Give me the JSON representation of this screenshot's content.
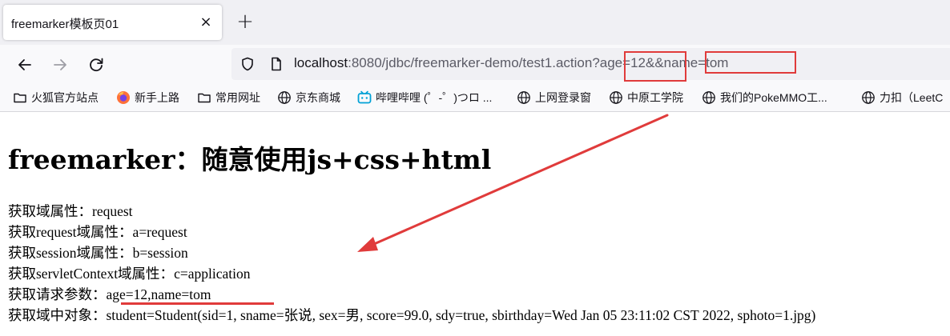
{
  "tab": {
    "title": "freemarker模板页01",
    "close_glyph": "×"
  },
  "new_tab_glyph": "+",
  "nav": {
    "back_icon": "arrow-left-icon",
    "forward_icon": "arrow-right-icon",
    "reload_icon": "reload-icon"
  },
  "url": {
    "host": "localhost",
    "rest": ":8080/jdbc/freemarker-demo/test1.action?age=12&&name=tom"
  },
  "bookmarks": [
    {
      "label": "火狐官方站点",
      "icon": "folder-icon"
    },
    {
      "label": "新手上路",
      "icon": "firefox-icon"
    },
    {
      "label": "常用网址",
      "icon": "folder-icon"
    },
    {
      "label": "京东商城",
      "icon": "globe-icon"
    },
    {
      "label": "哔哩哔哩 (゜-゜)つロ ...",
      "icon": "bilibili-icon"
    },
    {
      "label": "上网登录窗",
      "icon": "globe-icon"
    },
    {
      "label": "中原工学院",
      "icon": "globe-icon"
    },
    {
      "label": "我们的PokeMMO工...",
      "icon": "globe-icon"
    },
    {
      "label": "力扣（LeetC",
      "icon": "globe-icon"
    }
  ],
  "page": {
    "title": "freemarker：随意使用js+css+html",
    "lines": [
      {
        "label": "获取域属性：",
        "value": "request"
      },
      {
        "label": "获取request域属性：",
        "value": "a=request"
      },
      {
        "label": "获取session域属性：",
        "value": "b=session"
      },
      {
        "label": "获取servletContext域属性：",
        "value": "c=application"
      },
      {
        "label": "获取请求参数：",
        "value": "age=12,name=tom"
      },
      {
        "label": "获取域中对象：",
        "value": "student=Student(sid=1, sname=张说, sex=男, score=99.0, sdy=true, sbirthday=Wed Jan 05 23:11:02 CST 2022, sphoto=1.jpg)"
      }
    ]
  },
  "colors": {
    "annotation": "#e03b3b",
    "tabstrip": "#f0f0f4",
    "toolbar": "#f9f9fb"
  }
}
